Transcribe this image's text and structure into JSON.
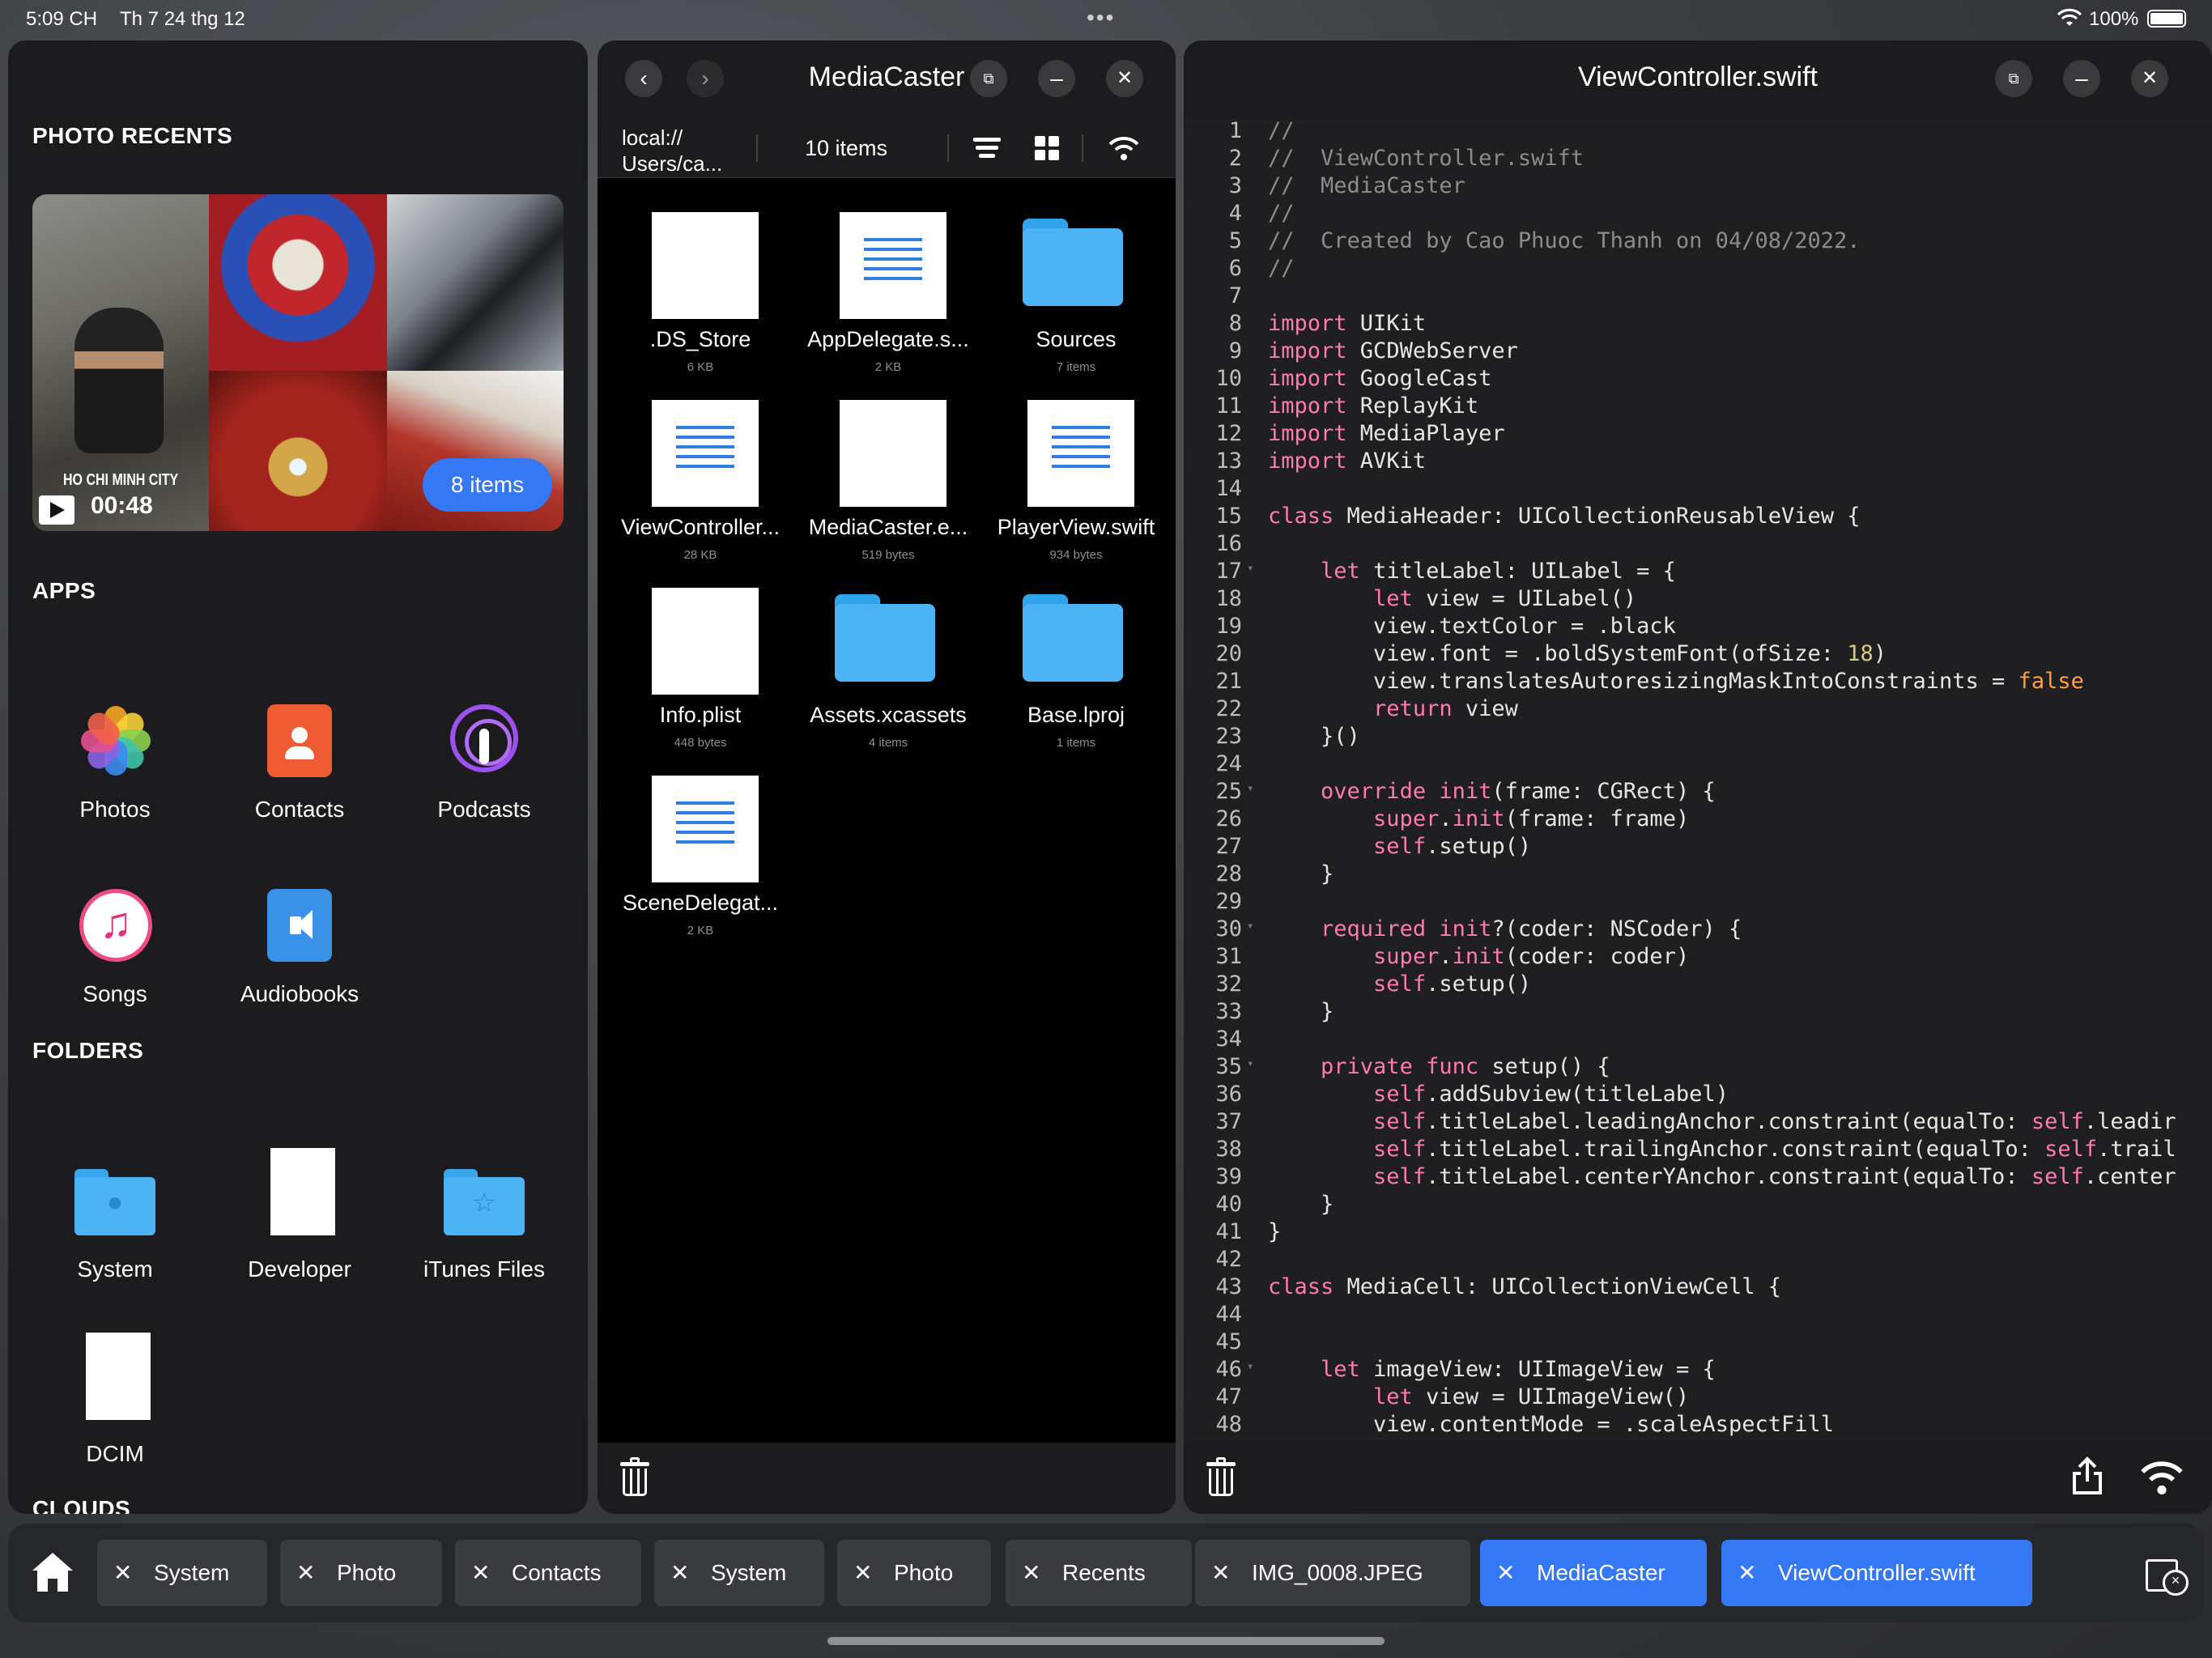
{
  "status_bar": {
    "time": "5:09 CH",
    "date": "Th 7 24 thg 12",
    "dots": "•••",
    "battery": "100%"
  },
  "left_panel": {
    "photo_recents_header": "PHOTO RECENTS",
    "recent_card": {
      "city": "HO CHI MINH CITY",
      "duration": "00:48",
      "items": "8 items"
    },
    "apps_header": "APPS",
    "apps": [
      {
        "label": "Photos",
        "icon": "photos-icon"
      },
      {
        "label": "Contacts",
        "icon": "contacts-icon"
      },
      {
        "label": "Podcasts",
        "icon": "podcasts-icon"
      },
      {
        "label": "Songs",
        "icon": "songs-icon"
      },
      {
        "label": "Audiobooks",
        "icon": "audiobooks-icon"
      }
    ],
    "folders_header": "FOLDERS",
    "folders": [
      {
        "label": "System",
        "icon": "apple-folder-icon"
      },
      {
        "label": "Developer",
        "icon": "blank-file-icon"
      },
      {
        "label": "iTunes Files",
        "icon": "star-folder-icon"
      },
      {
        "label": "DCIM",
        "icon": "blank-file-icon"
      }
    ],
    "clouds_header": "CLOUDS"
  },
  "media_caster": {
    "title": "MediaCaster",
    "back": "‹",
    "forward": "›",
    "path": [
      "local://",
      "Users/ca..."
    ],
    "item_count": "10 items",
    "files": [
      {
        "name": ".DS_Store",
        "size": "6 KB",
        "kind": "blank"
      },
      {
        "name": "AppDelegate.s...",
        "size": "2 KB",
        "kind": "doc"
      },
      {
        "name": "Sources",
        "size": "7 items",
        "kind": "folder"
      },
      {
        "name": "ViewController...",
        "size": "28 KB",
        "kind": "doc"
      },
      {
        "name": "MediaCaster.e...",
        "size": "519 bytes",
        "kind": "blank"
      },
      {
        "name": "PlayerView.swift",
        "size": "934 bytes",
        "kind": "doc"
      },
      {
        "name": "Info.plist",
        "size": "448 bytes",
        "kind": "blank"
      },
      {
        "name": "Assets.xcassets",
        "size": "4 items",
        "kind": "folder"
      },
      {
        "name": "Base.lproj",
        "size": "1 items",
        "kind": "folder"
      },
      {
        "name": "SceneDelegat...",
        "size": "2 KB",
        "kind": "doc"
      }
    ]
  },
  "editor": {
    "title": "ViewController.swift",
    "lines": [
      "//",
      "//  ViewController.swift",
      "//  MediaCaster",
      "//",
      "//  Created by Cao Phuoc Thanh on 04/08/2022.",
      "//",
      "",
      "import UIKit",
      "import GCDWebServer",
      "import GoogleCast",
      "import ReplayKit",
      "import MediaPlayer",
      "import AVKit",
      "",
      "class MediaHeader: UICollectionReusableView {",
      "",
      "    let titleLabel: UILabel = {",
      "        let view = UILabel()",
      "        view.textColor = .black",
      "        view.font = .boldSystemFont(ofSize: 18)",
      "        view.translatesAutoresizingMaskIntoConstraints = false",
      "        return view",
      "    }()",
      "",
      "    override init(frame: CGRect) {",
      "        super.init(frame: frame)",
      "        self.setup()",
      "    }",
      "",
      "    required init?(coder: NSCoder) {",
      "        super.init(coder: coder)",
      "        self.setup()",
      "    }",
      "",
      "    private func setup() {",
      "        self.addSubview(titleLabel)",
      "        self.titleLabel.leadingAnchor.constraint(equalTo: self.leadir",
      "        self.titleLabel.trailingAnchor.constraint(equalTo: self.trail",
      "        self.titleLabel.centerYAnchor.constraint(equalTo: self.center",
      "    }",
      "}",
      "",
      "class MediaCell: UICollectionViewCell {",
      "",
      "",
      "    let imageView: UIImageView = {",
      "        let view = UIImageView()",
      "        view.contentMode = .scaleAspectFill"
    ]
  },
  "taskbar": {
    "tabs": [
      {
        "label": "System",
        "active": false
      },
      {
        "label": "Photo",
        "active": false
      },
      {
        "label": "Contacts",
        "active": false
      },
      {
        "label": "System",
        "active": false
      },
      {
        "label": "Photo",
        "active": false
      },
      {
        "label": "Recents",
        "active": false
      },
      {
        "label": "IMG_0008.JPEG",
        "active": false
      },
      {
        "label": "MediaCaster",
        "active": true
      },
      {
        "label": "ViewController.swift",
        "active": true
      }
    ],
    "close_glyph": "✕"
  },
  "colors": {
    "accent": "#3478f6",
    "panel": "#1c1c1e",
    "folder": "#4cb4f5"
  }
}
